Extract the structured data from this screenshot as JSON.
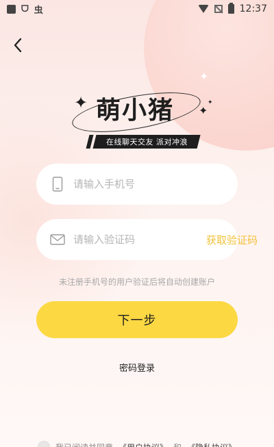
{
  "status_bar": {
    "left_glyph_1": "ᗜ",
    "left_glyph_2": "虫",
    "time": "12:37"
  },
  "header": {
    "back_icon": "chevron-left-icon"
  },
  "logo": {
    "title": "萌小猪",
    "tagline": "在线聊天交友 派对冲浪"
  },
  "form": {
    "phone_placeholder": "请输入手机号",
    "phone_value": "",
    "code_placeholder": "请输入验证码",
    "code_value": "",
    "get_code_label": "获取验证码",
    "hint": "未注册手机号的用户验证后将自动创建账户",
    "next_label": "下一步",
    "password_login_label": "密码登录"
  },
  "agreement": {
    "text_1": "我已阅读并同意",
    "user_agreement": "《用户协议》",
    "and": "和",
    "privacy_policy": "《隐私协议》"
  },
  "colors": {
    "accent": "#fcd843",
    "link_accent": "#f2c23a",
    "text_dark": "#1e1e1e",
    "hint": "#a8a8a8"
  }
}
